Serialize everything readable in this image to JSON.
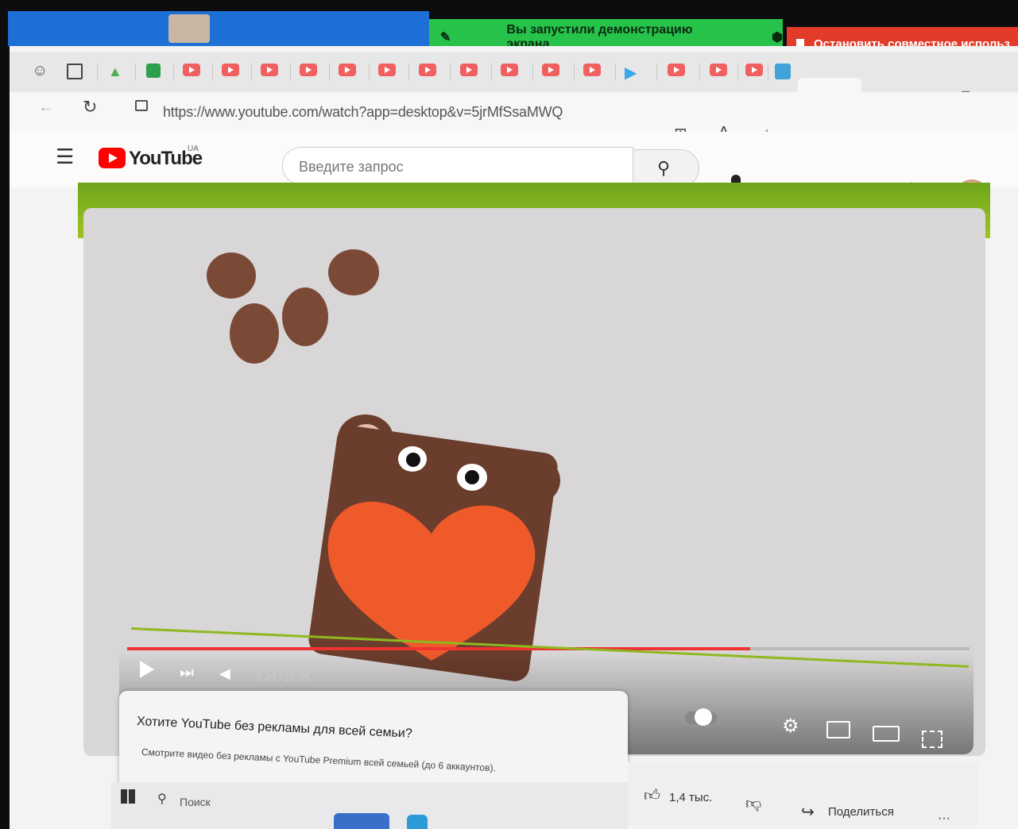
{
  "share": {
    "banner_text": "Вы запустили демонстрацию экрана",
    "stop_text": "Остановить совместное использ"
  },
  "browser": {
    "url": "https://www.youtube.com/watch?app=desktop&v=5jrMfSsaMWQ",
    "close_tab_glyph": "×",
    "new_tab_glyph": "+",
    "minimize_glyph": "–"
  },
  "youtube": {
    "logo_text": "YouTube",
    "region": "UA",
    "search_placeholder": "Введите запрос"
  },
  "player": {
    "time": "8:49 / 11:35",
    "progress": 0.74
  },
  "promo": {
    "title": "Хотите YouTube без рекламы для всей семьи?",
    "subtitle": "Смотрите видео без рекламы с YouTube Premium всей семьей (до 6 аккаунтов)."
  },
  "actions": {
    "likes": "1,4 тыс.",
    "share_label": "Поделиться",
    "more": "···"
  },
  "taskbar": {
    "search_label": "Поиск"
  },
  "colors": {
    "share_green": "#27c24a",
    "stop_red": "#e23b2a",
    "youtube_red": "#ff0000",
    "frame_green": "#8fb81f",
    "bear_brown": "#6b3d2c",
    "heart_orange": "#ee5a2a"
  }
}
